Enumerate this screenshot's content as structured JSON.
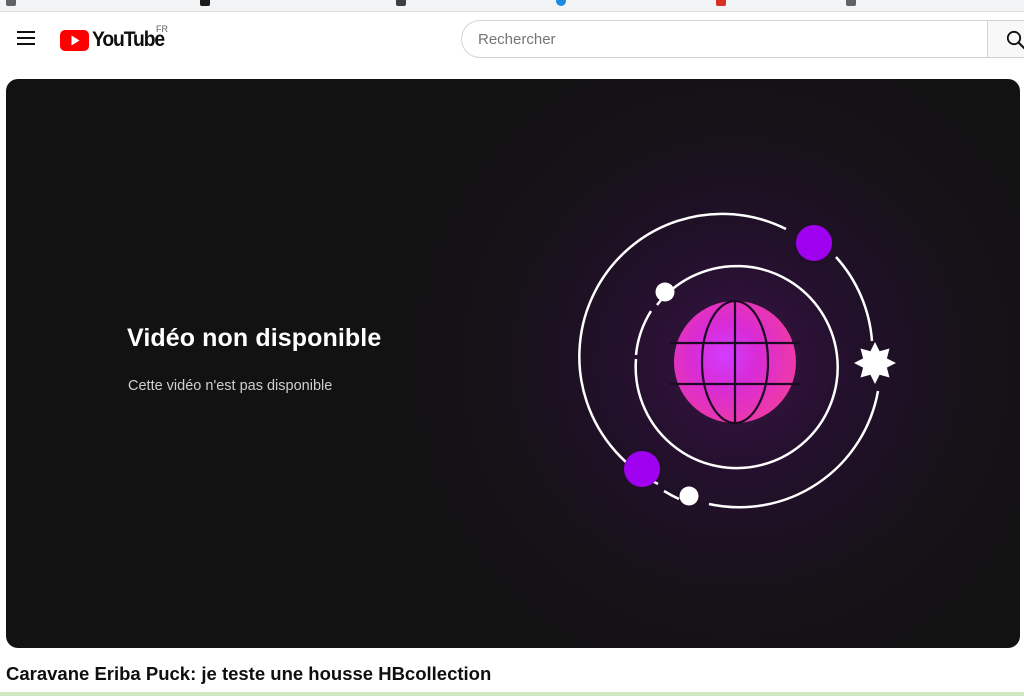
{
  "masthead": {
    "logo_text": "YouTube",
    "country_code": "FR",
    "search_placeholder": "Rechercher",
    "brand_color": "#ff0000"
  },
  "player": {
    "error_title": "Vidéo non disponible",
    "error_message": "Cette vidéo n'est pas disponible",
    "background_color": "#121212",
    "accent_color": "#a000f0"
  },
  "video": {
    "title": "Caravane Eriba Puck: je teste une housse HBcollection"
  },
  "icons": {
    "menu": "hamburger-menu-icon",
    "search": "search-icon",
    "logo": "youtube-logo-icon",
    "illustration": "globe-orbit-illustration"
  }
}
